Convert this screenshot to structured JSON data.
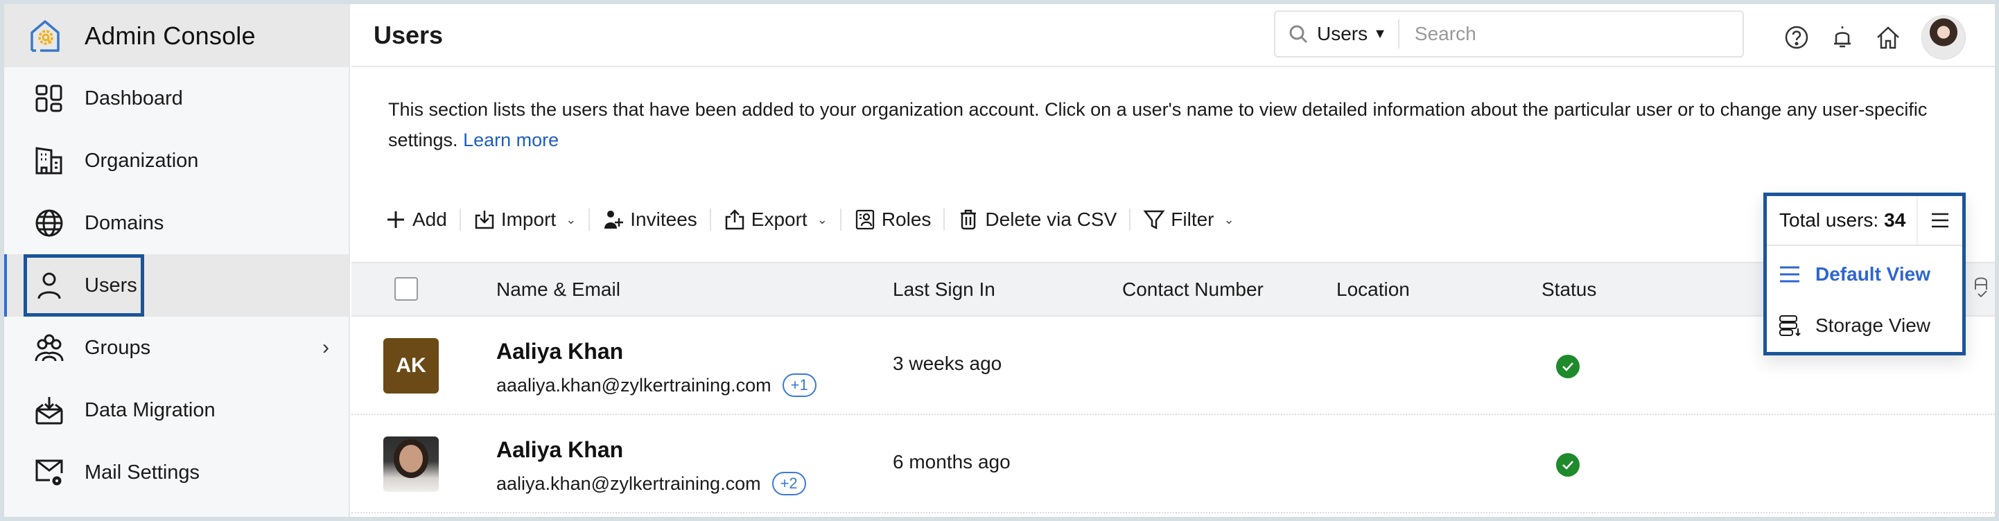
{
  "app": {
    "title": "Admin Console"
  },
  "sidebar": {
    "items": [
      {
        "label": "Dashboard",
        "icon": "dashboard-icon"
      },
      {
        "label": "Organization",
        "icon": "building-icon"
      },
      {
        "label": "Domains",
        "icon": "globe-icon"
      },
      {
        "label": "Users",
        "icon": "user-icon",
        "active": true
      },
      {
        "label": "Groups",
        "icon": "groups-icon",
        "has_submenu": true
      },
      {
        "label": "Data Migration",
        "icon": "mail-download-icon"
      },
      {
        "label": "Mail Settings",
        "icon": "mail-gear-icon"
      }
    ]
  },
  "header": {
    "page_title": "Users",
    "search": {
      "scope": "Users",
      "placeholder": "Search",
      "value": ""
    },
    "icons": [
      "help-icon",
      "bell-icon",
      "home-icon",
      "profile-avatar"
    ]
  },
  "description": {
    "text": "This section lists the users that have been added to your organization account. Click on a user's name to view detailed information about the particular user or to change any user-specific settings.",
    "link": "Learn more"
  },
  "toolbar": {
    "add": "Add",
    "import": "Import",
    "invitees": "Invitees",
    "export": "Export",
    "roles": "Roles",
    "delete_csv": "Delete via CSV",
    "filter": "Filter"
  },
  "view_panel": {
    "total_label": "Total users:",
    "total_count": "34",
    "options": [
      {
        "label": "Default View",
        "selected": true
      },
      {
        "label": "Storage View",
        "selected": false
      }
    ]
  },
  "table": {
    "columns": [
      "Name & Email",
      "Last Sign In",
      "Contact Number",
      "Location",
      "Status"
    ],
    "rows": [
      {
        "initials": "AK",
        "avatar_color": "#6b4a17",
        "name": "Aaliya Khan",
        "email": "aaaliya.khan@zylkertraining.com",
        "extra_emails": "+1",
        "last_sign_in": "3 weeks ago",
        "contact": "",
        "location": "",
        "status": "active"
      },
      {
        "initials": "",
        "avatar_color": "",
        "name": "Aaliya Khan",
        "email": "aaliya.khan@zylkertraining.com",
        "extra_emails": "+2",
        "last_sign_in": "6 months ago",
        "contact": "",
        "location": "",
        "status": "active"
      }
    ]
  },
  "colors": {
    "accent": "#2f66d0",
    "link": "#1f5fbf",
    "highlight_outline": "#1b5499",
    "status_active": "#1e8a2c"
  }
}
